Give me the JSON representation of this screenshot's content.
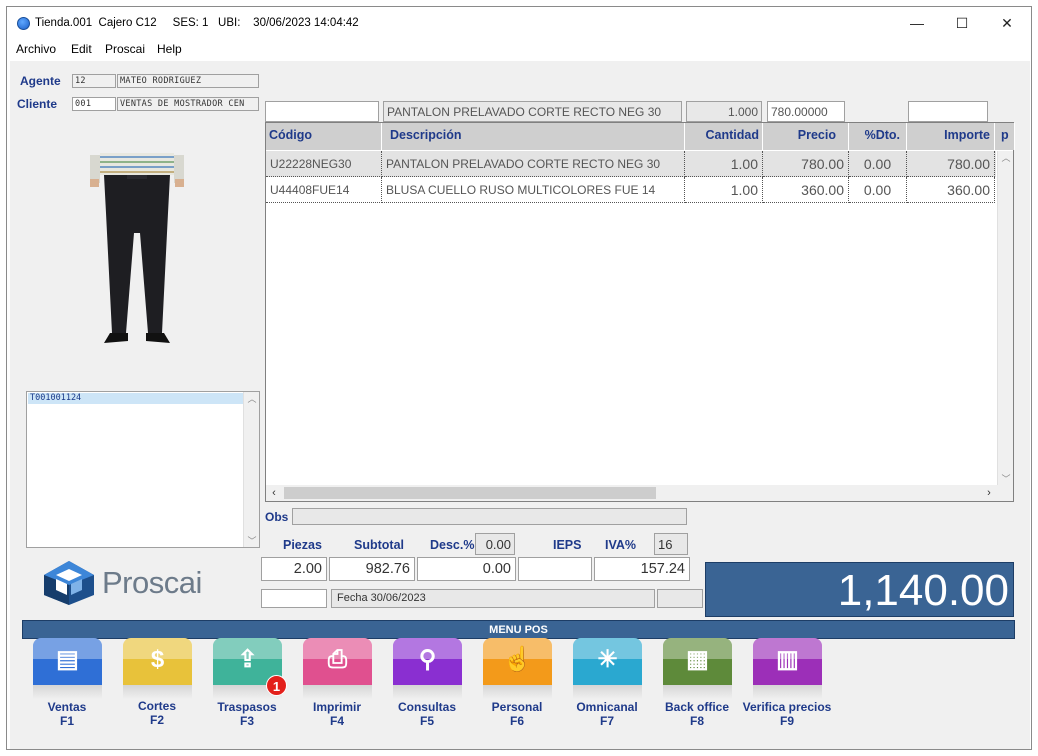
{
  "window": {
    "title": "Tienda.001  Cajero C12     SES: 1   UBI:    30/06/2023 14:04:42",
    "minimize": "—",
    "maximize": "☐",
    "close": "✕"
  },
  "menu": [
    "Archivo",
    "Edit",
    "Proscai",
    "Help"
  ],
  "agente": {
    "label": "Agente",
    "code": "12",
    "name": "MATEO RODRIGUEZ"
  },
  "cliente": {
    "label": "Cliente",
    "code": "001",
    "name": "VENTAS DE MOSTRADOR CEN"
  },
  "list": {
    "selected": "T001001124"
  },
  "entry": {
    "codigo": "",
    "descripcion": "PANTALON PRELAVADO CORTE RECTO NEG 30",
    "cantidad": "1.000",
    "precio": "780.00000",
    "extra": ""
  },
  "grid": {
    "headers": [
      "Código",
      "Descripción",
      "Cantidad",
      "Precio",
      "%Dto.",
      "Importe",
      "p"
    ],
    "rows": [
      [
        "U22228NEG30",
        "PANTALON PRELAVADO CORTE RECTO NEG 30",
        "1.00",
        "780.00",
        "0.00",
        "780.00"
      ],
      [
        "U44408FUE14",
        "BLUSA CUELLO RUSO MULTICOLORES FUE 14",
        "1.00",
        "360.00",
        "0.00",
        "360.00"
      ]
    ]
  },
  "obs": {
    "label": "Obs",
    "value": ""
  },
  "totals": {
    "piezas_label": "Piezas",
    "subtotal_label": "Subtotal",
    "desc_label": "Desc.%",
    "desc_pct": "0.00",
    "ieps_label": "IEPS",
    "iva_label": "IVA%",
    "iva_pct": "16",
    "piezas": "2.00",
    "subtotal": "982.76",
    "descuento": "0.00",
    "ieps": "",
    "iva": "157.24",
    "total": "1,140.00"
  },
  "logo": {
    "text": "Proscai"
  },
  "fecha": "Fecha 30/06/2023",
  "menu_pos": {
    "title": "MENU POS",
    "buttons": [
      {
        "label": "Ventas",
        "key": "F1",
        "color": "#2f6fd6",
        "icon": "register-icon"
      },
      {
        "label": "Cortes",
        "key": "F2",
        "color": "#e8c23a",
        "icon": "cash-icon"
      },
      {
        "label": "Traspasos",
        "key": "F3",
        "color": "#3fb39a",
        "icon": "transfer-icon",
        "badge": "1"
      },
      {
        "label": "Imprimir",
        "key": "F4",
        "color": "#e0508f",
        "icon": "printer-icon"
      },
      {
        "label": "Consultas",
        "key": "F5",
        "color": "#8a2fd1",
        "icon": "magnifier-icon"
      },
      {
        "label": "Personal",
        "key": "F6",
        "color": "#f39a1a",
        "icon": "hand-icon"
      },
      {
        "label": "Omnicanal",
        "key": "F7",
        "color": "#2aa8d0",
        "icon": "network-icon"
      },
      {
        "label": "Back office",
        "key": "F8",
        "color": "#5e8a3a",
        "icon": "building-icon"
      },
      {
        "label": "Verifica precios",
        "key": "F9",
        "color": "#9c2fb8",
        "icon": "barcode-icon"
      }
    ]
  }
}
